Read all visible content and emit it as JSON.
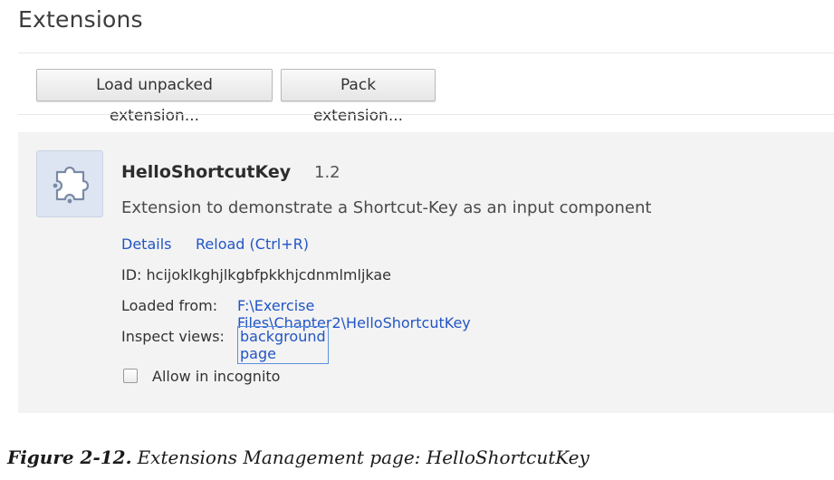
{
  "page": {
    "title": "Extensions"
  },
  "toolbar": {
    "load_unpacked_label": "Load unpacked extension...",
    "pack_label": "Pack extension..."
  },
  "extension": {
    "icon": "puzzle-piece-icon",
    "name": "HelloShortcutKey",
    "version": "1.2",
    "description": "Extension to demonstrate a Shortcut-Key as an input component",
    "details_link": "Details",
    "reload_link": "Reload (Ctrl+R)",
    "id_text": "ID: hcijoklkghjlkgbfpkkhjcdnmlmljkae",
    "loaded_from_label": "Loaded from:",
    "loaded_from_path": "F:\\Exercise Files\\Chapter2\\HelloShortcutKey",
    "inspect_views_label": "Inspect views:",
    "inspect_views_link": "background page",
    "incognito_label": "Allow in incognito",
    "incognito_checked": false
  },
  "caption": {
    "label": "Figure 2-12.",
    "text": "Extensions Management page: HelloShortcutKey"
  },
  "colors": {
    "link": "#2255c4",
    "card_background": "#f3f3f3",
    "icon_background": "#dde5f2"
  }
}
